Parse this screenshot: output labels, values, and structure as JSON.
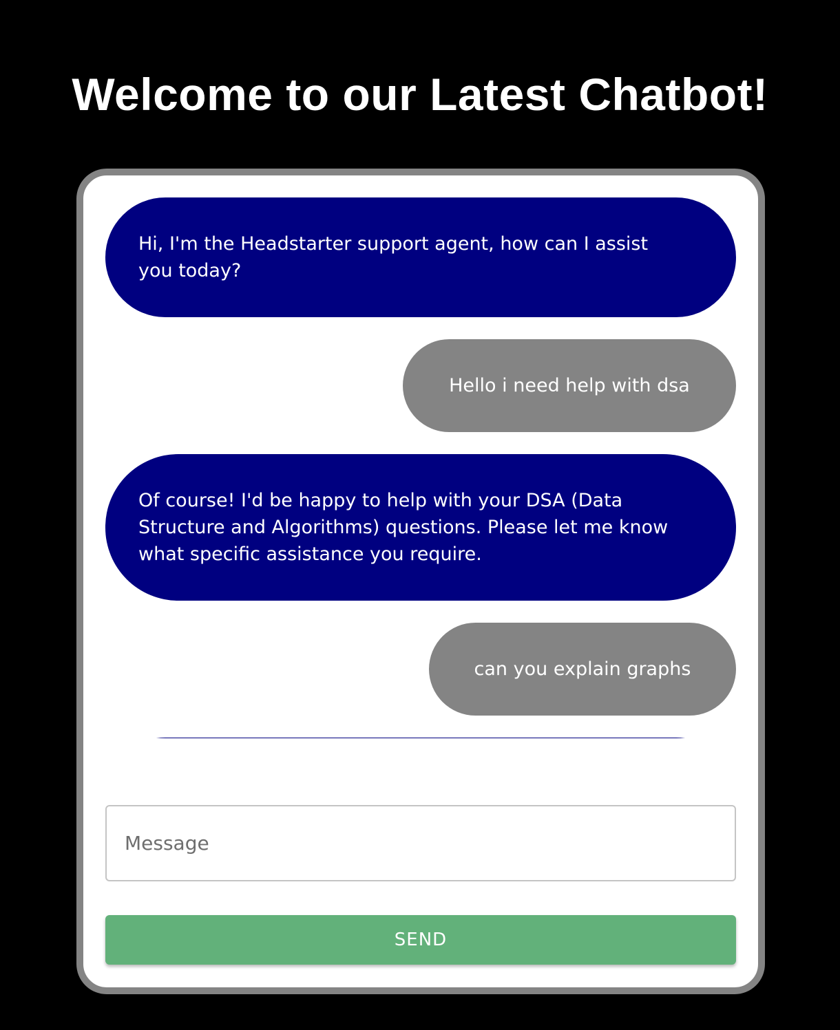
{
  "header": {
    "title": "Welcome to our Latest Chatbot!"
  },
  "chat": {
    "messages": [
      {
        "role": "assistant",
        "text": "Hi, I'm the Headstarter support agent, how can I assist you today?"
      },
      {
        "role": "user",
        "text": "Hello i need help with dsa"
      },
      {
        "role": "assistant",
        "text": "Of course! I'd be happy to help with your DSA (Data Structure and Algorithms) questions. Please let me know what specific assistance you require."
      },
      {
        "role": "user",
        "text": "can you explain graphs"
      },
      {
        "role": "assistant",
        "text": ""
      }
    ]
  },
  "composer": {
    "placeholder": "Message",
    "value": "",
    "send_label": "SEND"
  },
  "colors": {
    "background": "#000000",
    "assistant_bubble": "#000080",
    "user_bubble": "#848484",
    "card_border": "#848484",
    "send_button": "#62b17a"
  }
}
